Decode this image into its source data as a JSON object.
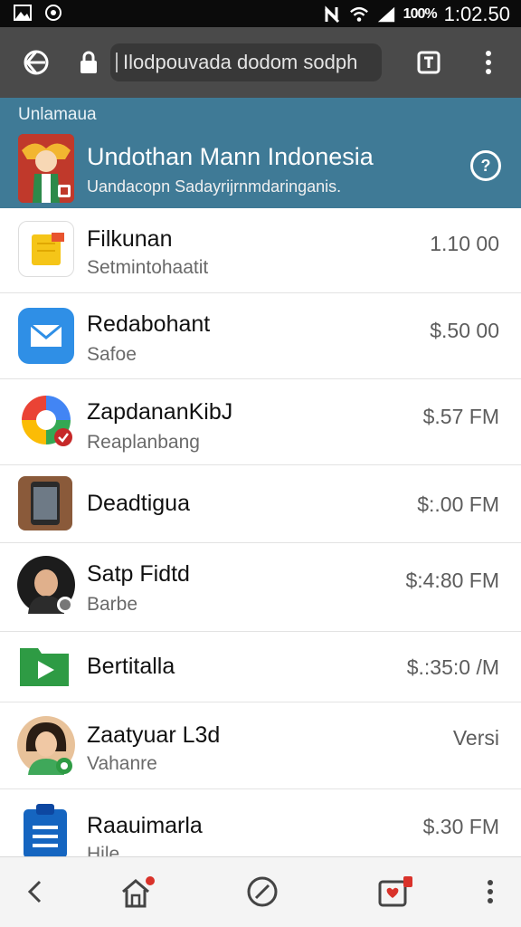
{
  "status_bar": {
    "battery": "100%",
    "time": "1:02.50",
    "icons": [
      "gallery-icon",
      "whatsapp-icon",
      "mute-icon",
      "wifi-icon",
      "signal-icon"
    ]
  },
  "browser": {
    "url": "Ilodpouvada dodom sodph",
    "icons": [
      "home-icon",
      "lock-icon",
      "tabs-icon",
      "menu-icon"
    ]
  },
  "header": {
    "crumb": "Unlamaua",
    "title": "Undothan Mann Indonesia",
    "subtitle": "Uandacopn  Sadayrijrnmdaringanis.",
    "help": "?"
  },
  "list": [
    {
      "title": "Filkunan",
      "subtitle": "Setmintohaatit",
      "price": "1.10 00",
      "icon": "notes-app-icon"
    },
    {
      "title": "Redabohant",
      "subtitle": "Safoe",
      "price": "$.50 00",
      "icon": "mail-app-icon"
    },
    {
      "title": "ZapdananKibJ",
      "subtitle": "Reaplanbang",
      "price": "$.57 FM",
      "icon": "colorful-app-icon"
    },
    {
      "title": "Deadtigua",
      "subtitle": "",
      "price": "$:.00 FM",
      "icon": "phone-device-icon"
    },
    {
      "title": "Satp Fidtd",
      "subtitle": "Barbe",
      "price": "$:4:80 FM",
      "icon": "avatar-woman-hijab"
    },
    {
      "title": "Bertitalla",
      "subtitle": "",
      "price": "$.:35:0 /M",
      "icon": "play-folder-icon"
    },
    {
      "title": "Zaatyuar L3d",
      "subtitle": "Vahanre",
      "price": "Versi",
      "icon": "avatar-woman"
    },
    {
      "title": "Raauimarla",
      "subtitle": "Hile",
      "price": "$.30 FM",
      "icon": "clipboard-icon"
    }
  ],
  "bottom_nav": [
    "back-icon",
    "home-icon",
    "compass-icon",
    "inbox-icon",
    "more-icon"
  ],
  "colors": {
    "header_bg": "#3f7a96",
    "toolbar_bg": "#4a4a4a",
    "status_bg": "#0b0b0b",
    "badge_red": "#d9322a"
  }
}
